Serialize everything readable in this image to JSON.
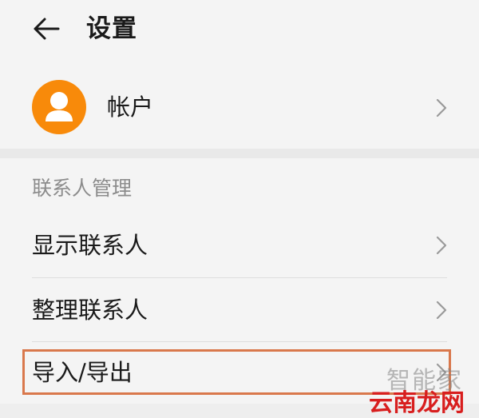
{
  "header": {
    "title": "设置"
  },
  "account": {
    "label": "帐户",
    "avatar_color": "#f88a0a"
  },
  "contacts_section": {
    "header": "联系人管理",
    "items": [
      {
        "label": "显示联系人"
      },
      {
        "label": "整理联系人"
      },
      {
        "label": "导入/导出"
      }
    ]
  },
  "highlight_color": "#d9784c",
  "watermark": {
    "top_text": "智能家",
    "bottom_text": "云南龙网",
    "bottom_color": "#d81e1e"
  },
  "icons": [
    "back-arrow-icon",
    "person-icon",
    "chevron-right-icon"
  ]
}
